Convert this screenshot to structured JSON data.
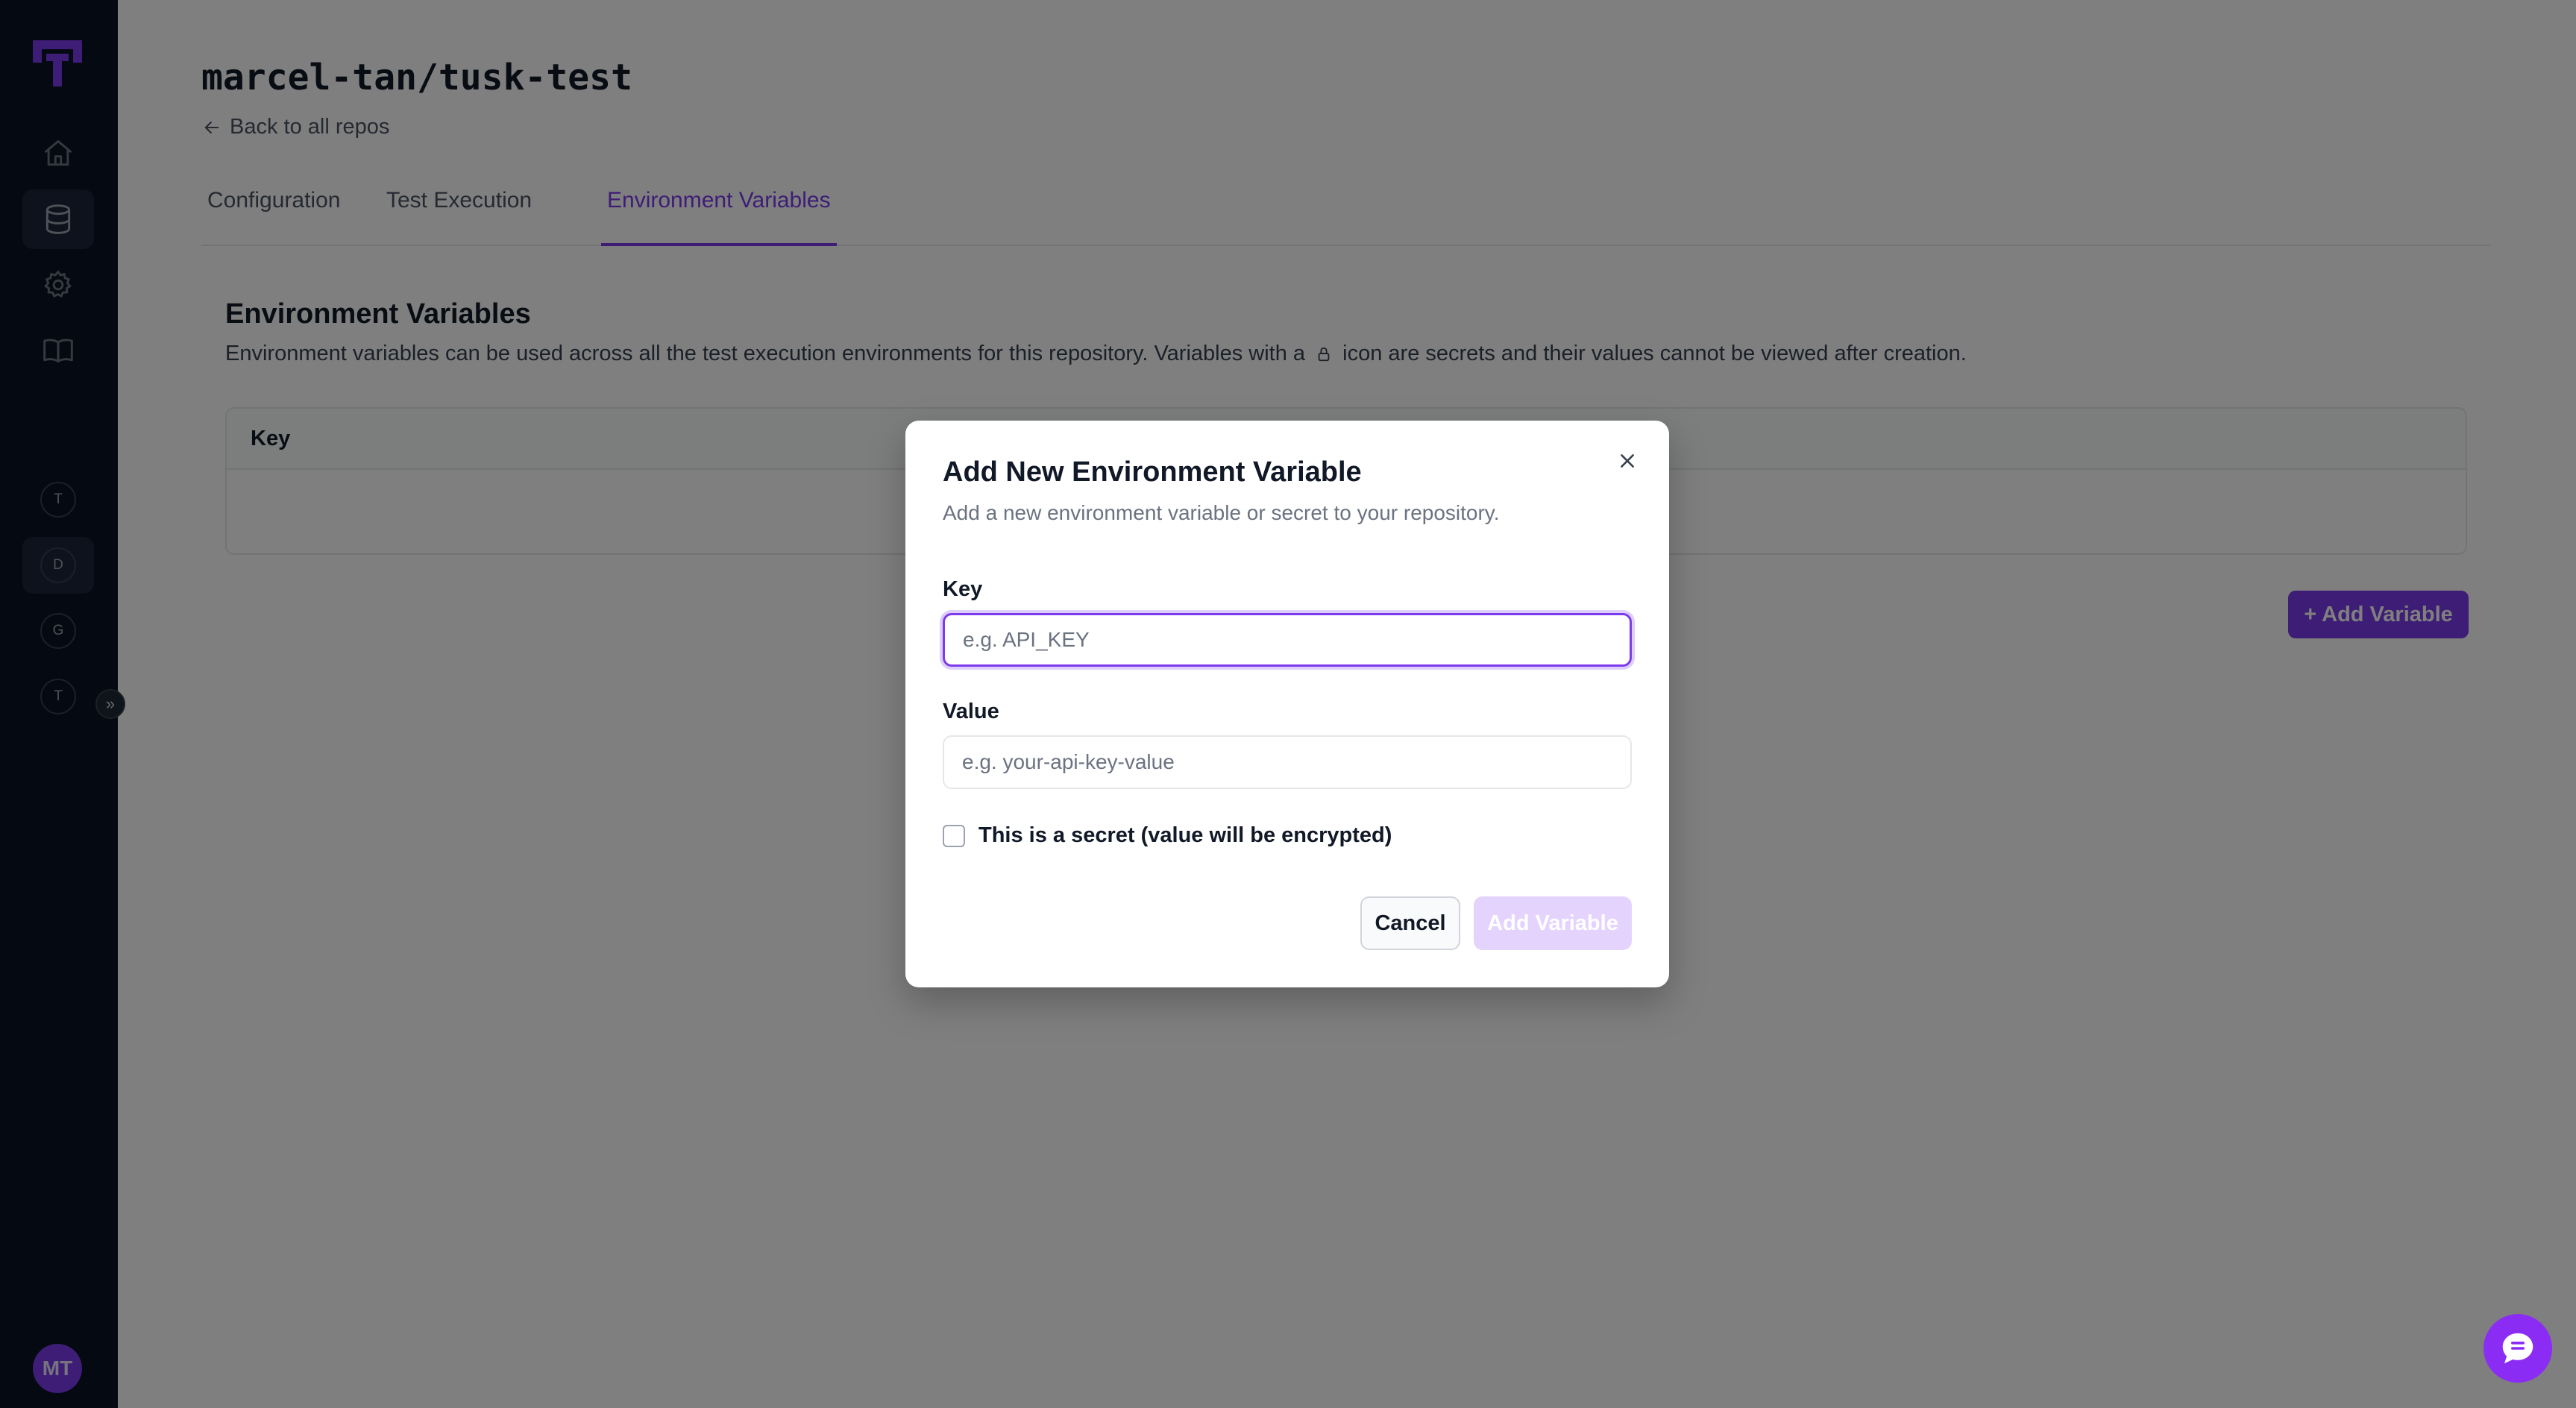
{
  "sidebar": {
    "nav": [
      {
        "name": "home",
        "icon": "home-icon"
      },
      {
        "name": "repos",
        "icon": "database-icon",
        "active": true
      },
      {
        "name": "settings",
        "icon": "gear-icon"
      },
      {
        "name": "docs",
        "icon": "book-icon"
      }
    ],
    "workspaces": [
      {
        "label": "T"
      },
      {
        "label": "D"
      },
      {
        "label": "G"
      },
      {
        "label": "T"
      }
    ],
    "avatar_initials": "MT"
  },
  "header": {
    "repo_title": "marcel-tan/tusk-test",
    "back_link": "Back to all repos"
  },
  "tabs": [
    {
      "label": "Configuration"
    },
    {
      "label": "Test Execution"
    },
    {
      "label": "Environment Variables",
      "active": true
    }
  ],
  "section": {
    "title": "Environment Variables",
    "desc_before": "Environment variables can be used across all the test execution environments for this repository. Variables with a",
    "desc_after": "icon are secrets and their values cannot be viewed after creation."
  },
  "table": {
    "columns": [
      "Key"
    ]
  },
  "add_variable_button": "+ Add Variable",
  "modal": {
    "title": "Add New Environment Variable",
    "description": "Add a new environment variable or secret to your repository.",
    "key_label": "Key",
    "key_placeholder": "e.g. API_KEY",
    "key_value": "",
    "value_label": "Value",
    "value_placeholder": "e.g. your-api-key-value",
    "value_value": "",
    "secret_checkbox_label": "This is a secret (value will be encrypted)",
    "secret_checked": false,
    "cancel_label": "Cancel",
    "submit_label": "Add Variable"
  },
  "colors": {
    "accent": "#7c3aed",
    "sidebar_bg": "#0b1222",
    "chat_bubble": "#8b2cf5"
  }
}
